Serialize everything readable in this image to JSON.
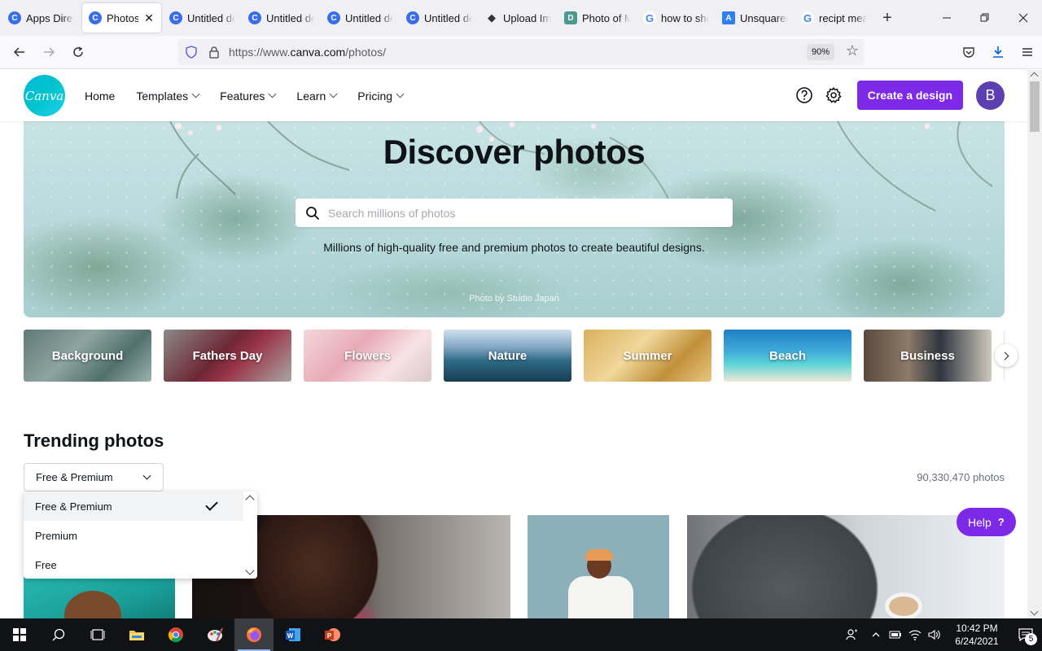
{
  "browser": {
    "tabs": [
      {
        "label": "Apps Directory",
        "favicon": "canva-favicon",
        "active": false
      },
      {
        "label": "Photos",
        "favicon": "canva-favicon",
        "active": true
      },
      {
        "label": "Untitled design",
        "favicon": "canva-favicon",
        "active": false
      },
      {
        "label": "Untitled design",
        "favicon": "canva-favicon",
        "active": false
      },
      {
        "label": "Untitled design",
        "favicon": "canva-favicon",
        "active": false
      },
      {
        "label": "Untitled design",
        "favicon": "canva-favicon",
        "active": false
      },
      {
        "label": "Upload Images",
        "favicon": "upload-favicon",
        "active": false
      },
      {
        "label": "Photo of Me",
        "favicon": "d-favicon",
        "active": false
      },
      {
        "label": "how to show",
        "favicon": "google-favicon",
        "active": false
      },
      {
        "label": "Unsquared",
        "favicon": "unsquared-favicon",
        "active": false
      },
      {
        "label": "recipt meaning",
        "favicon": "google-favicon",
        "active": false
      }
    ],
    "close_glyph": "✕",
    "new_tab_glyph": "+",
    "url_prefix": "https://www.",
    "url_host": "canva.com",
    "url_path": "/photos/",
    "zoom": "90%"
  },
  "header": {
    "logo_text": "Canva",
    "menu": [
      {
        "label": "Home",
        "has_chevron": false
      },
      {
        "label": "Templates",
        "has_chevron": true
      },
      {
        "label": "Features",
        "has_chevron": true
      },
      {
        "label": "Learn",
        "has_chevron": true
      },
      {
        "label": "Pricing",
        "has_chevron": true
      }
    ],
    "create_label": "Create a design",
    "avatar_initial": "B",
    "accent": "#7d2ae8"
  },
  "hero": {
    "title": "Discover photos",
    "search_placeholder": "Search millions of photos",
    "subtitle": "Millions of high-quality free and premium photos to create beautiful designs.",
    "credit": "Photo by Studio Japan"
  },
  "categories": [
    {
      "label": "Background",
      "bg": "linear-gradient(135deg,#5f7a78,#8ea4a0 40%,#51706d 70%,#9db2ae)"
    },
    {
      "label": "Fathers Day",
      "bg": "linear-gradient(135deg,#8b8a88,#6e2735 45%,#9a3447 60%,#a8a6a3)"
    },
    {
      "label": "Flowers",
      "bg": "linear-gradient(135deg,#f3d7dc,#e8aab6 40%,#f7e3e6 70%,#d9c7c9)"
    },
    {
      "label": "Nature",
      "bg": "linear-gradient(180deg,#cfe0ee 0%,#7fa4c2 35%,#2f6a86 60%,#173e52 100%)"
    },
    {
      "label": "Summer",
      "bg": "linear-gradient(135deg,#d8b15c,#f1d79b 40%,#c2903b 70%,#e7c67f)"
    },
    {
      "label": "Beach",
      "bg": "linear-gradient(180deg,#1f7fc4 0%,#3da9d8 40%,#59d3d6 65%,#efe8d5 100%)"
    },
    {
      "label": "Business",
      "bg": "linear-gradient(90deg,#5a4a3e,#8d7a68 35%,#2f3640 60%,#cfc8bd)"
    }
  ],
  "trending": {
    "title": "Trending photos",
    "filter_value": "Free & Premium",
    "count": "90,330,470 photos",
    "options": [
      {
        "label": "Free & Premium",
        "selected": true
      },
      {
        "label": "Premium",
        "selected": false
      },
      {
        "label": "Free",
        "selected": false
      }
    ]
  },
  "help": {
    "label": "Help",
    "glyph": "?"
  },
  "taskbar": {
    "time": "10:42 PM",
    "date": "6/24/2021",
    "notifications": "5"
  }
}
